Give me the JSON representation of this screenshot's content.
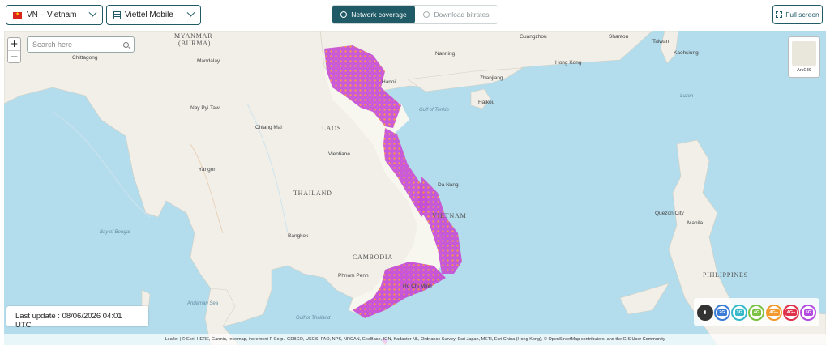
{
  "topbar": {
    "country": "VN – Vietnam",
    "operator": "Viettel Mobile",
    "tab_coverage": "Network coverage",
    "tab_bitrates": "Download bitrates",
    "fullscreen": "Full screen"
  },
  "map": {
    "search_placeholder": "Search here",
    "zoom_in": "+",
    "zoom_out": "−",
    "basemap_label": "ArcGIS",
    "last_update": "Last update : 08/06/2026 04:01 UTC",
    "attribution": "Leaflet | © Esri, HERE, Garmin, Intermap, increment P Corp., GEBCO, USGS, FAO, NPS, NRCAN, GeoBase, IGN, Kadaster NL, Ordnance Survey, Esri Japan, METI, Esri China (Hong Kong), © OpenStreetMap contributors, and the GIS User Community",
    "labels": {
      "myanmar": "MYANMAR",
      "burma": "(BURMA)",
      "laos": "LAOS",
      "thailand": "THAILAND",
      "cambodia": "CAMBODIA",
      "vietnam": "VIETNAM",
      "philippines": "PHILIPPINES",
      "taiwan": "Taiwan",
      "bay_of_bengal": "Bay of Bengal",
      "andaman_sea": "Andaman Sea",
      "gulf_thailand": "Gulf of Thailand",
      "gulf_tonkin": "Gulf of Tonkin",
      "luzon": "Luzon",
      "mandalay": "Mandalay",
      "naypyitaw": "Nay Pyi Taw",
      "yangon": "Yangon",
      "chiangmai": "Chiang Mai",
      "vientiane": "Vientiane",
      "bangkok": "Bangkok",
      "phnompenh": "Phnom Penh",
      "hanoi": "Hanoi",
      "danang": "Da Nang",
      "hochiminh": "Ho Chi Minh",
      "guangzhou": "Guangzhou",
      "hongkong": "Hong Kong",
      "nanning": "Nanning",
      "haikou": "Haikou",
      "shantou": "Shantou",
      "kaohsiung": "Kaohsiung",
      "manila": "Manila",
      "quezon": "Quezon City",
      "chittagong": "Chittagong",
      "zhanjiang": "Zhanjiang"
    },
    "legend": [
      "2G",
      "3G",
      "4G",
      "4G+",
      "4G+",
      "5G"
    ]
  },
  "colors": {
    "accent": "#1f5a66",
    "coverage_magenta": "#b44be0",
    "coverage_orange": "#ff8a3d",
    "coverage_pink": "#e24ab8",
    "sea": "#b3dcec",
    "land": "#f1efe8"
  }
}
